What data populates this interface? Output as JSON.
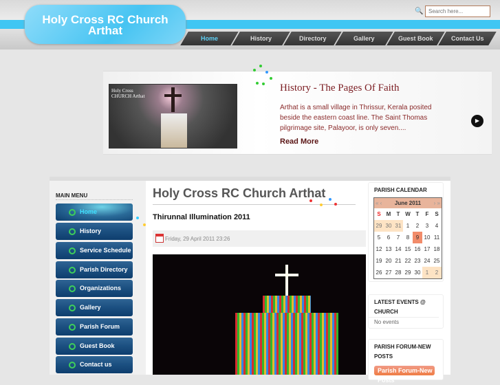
{
  "site": {
    "title_line1": "Holy Cross RC Church",
    "title_line2": "Arthat"
  },
  "search": {
    "placeholder": "Search here..."
  },
  "nav": [
    "Home",
    "History",
    "Directory",
    "Gallery",
    "Guest Book",
    "Contact Us"
  ],
  "slider": {
    "image_caption_line1": "Holy Cross",
    "image_caption_line2": "CHURCH Arthat",
    "title": "History - The Pages Of Faith",
    "text": "Arthat is a small village in Thrissur, Kerala posited beside the eastern coast line. The Saint Thomas pilgrimage site, Palayoor, is only seven....",
    "read_more": "Read More"
  },
  "main_menu": {
    "title": "MAIN MENU",
    "items": [
      "Home",
      "History",
      "Service Schedule",
      "Parish Directory",
      "Organizations",
      "Gallery",
      "Parish Forum",
      "Guest Book",
      "Contact us"
    ]
  },
  "content": {
    "page_title": "Holy Cross RC Church Arthat",
    "article_title": "Thirunnal Illumination 2011",
    "date": "Friday, 29 April 2011 23:26"
  },
  "calendar": {
    "title": "PARISH CALENDAR",
    "month": "June 2011",
    "prev": "« ‹",
    "next": "› »",
    "days": [
      "S",
      "M",
      "T",
      "W",
      "T",
      "F",
      "S"
    ],
    "dates": [
      "29",
      "30",
      "31",
      "1",
      "2",
      "3",
      "4",
      "5",
      "6",
      "7",
      "8",
      "9",
      "10",
      "11",
      "12",
      "13",
      "14",
      "15",
      "16",
      "17",
      "18",
      "19",
      "20",
      "21",
      "22",
      "23",
      "24",
      "25",
      "26",
      "27",
      "28",
      "29",
      "30",
      "1",
      "2"
    ]
  },
  "events": {
    "title": "LATEST EVENTS @ CHURCH",
    "empty": "No events"
  },
  "forum": {
    "title": "PARISH FORUM-NEW POSTS",
    "button": "Parish Forum-New Posts"
  }
}
